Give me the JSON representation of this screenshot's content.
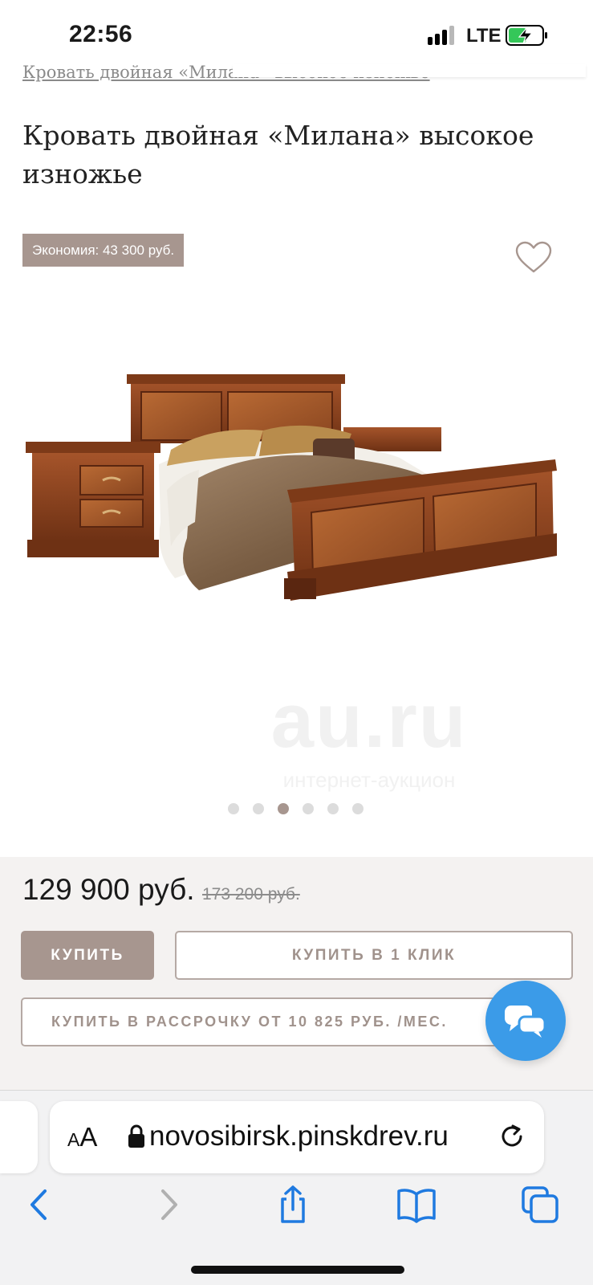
{
  "status_bar": {
    "time": "22:56",
    "network": "LTE",
    "icons": [
      "signal-icon",
      "battery-charging-icon"
    ]
  },
  "breadcrumb": "Кровать двойная «Милана» высокое изножье",
  "product": {
    "title": "Кровать двойная «Милана» высокое изножье",
    "savings": "Экономия: 43 300 руб.",
    "image_alt": "wooden-double-bed-with-nightstand",
    "watermark": {
      "big": "au.ru",
      "small": "интернет-аукцион"
    },
    "carousel": {
      "count": 6,
      "active_index": 2
    }
  },
  "purchase": {
    "price": "129 900 руб.",
    "old_price": "173 200 руб.",
    "buy_label": "КУПИТЬ",
    "one_click_label": "КУПИТЬ В 1 КЛИК",
    "installment_label": "КУПИТЬ В РАССРОЧКУ ОТ 10 825 РУБ. /МЕС."
  },
  "browser": {
    "text_size_label": "AA",
    "url": "novosibirsk.pinskdrev.ru",
    "toolbar": [
      "back-icon",
      "forward-icon",
      "share-icon",
      "bookmarks-icon",
      "tabs-icon"
    ]
  },
  "colors": {
    "accent": "#a7968f",
    "chat": "#3b9be8",
    "ios_blue": "#1f7ae0",
    "panel_bg": "#f4f2f1"
  }
}
